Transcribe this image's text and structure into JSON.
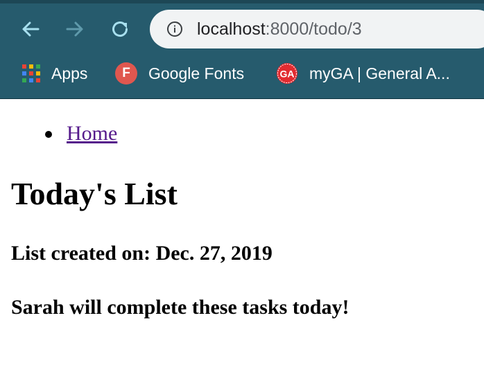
{
  "browser": {
    "url_host": "localhost",
    "url_path": ":8000/todo/3",
    "back_icon": "arrow-left-icon",
    "forward_icon": "arrow-right-icon",
    "reload_icon": "reload-icon",
    "info_icon": "info-icon",
    "bookmarks": [
      {
        "label": "Apps",
        "icon": "apps-grid-icon"
      },
      {
        "label": "Google Fonts",
        "icon": "google-fonts-favicon",
        "icon_text": "F"
      },
      {
        "label": "myGA | General A...",
        "icon": "general-assembly-favicon",
        "icon_text": "GA"
      }
    ],
    "colors": {
      "chrome_bg": "#265b6d",
      "omnibox_bg": "#f1f3f4",
      "nav_icon_active": "#a8e0ef",
      "nav_icon_disabled": "#5f9aab"
    }
  },
  "page": {
    "nav_links": [
      {
        "label": "Home"
      }
    ],
    "title": "Today's List",
    "created_label": "List created on: Dec. 27, 2019",
    "tasks_heading": "Sarah will complete these tasks today!",
    "colors": {
      "link": "#551a8b",
      "text": "#000000"
    }
  }
}
